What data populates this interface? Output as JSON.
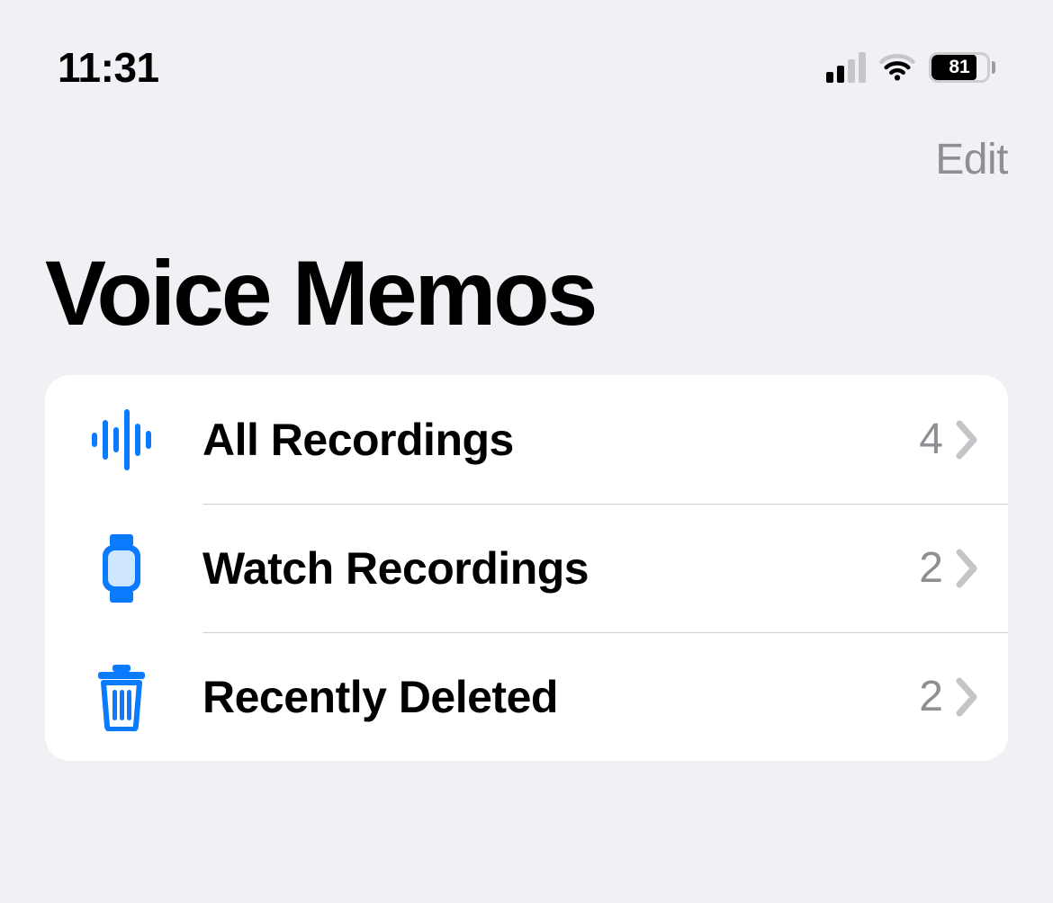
{
  "status_bar": {
    "time": "11:31",
    "battery_percent": "81",
    "cellular_bars_active": 2,
    "wifi_active": true
  },
  "nav": {
    "edit_label": "Edit"
  },
  "page": {
    "title": "Voice Memos"
  },
  "folders": [
    {
      "icon": "waveform",
      "label": "All Recordings",
      "count": "4"
    },
    {
      "icon": "watch",
      "label": "Watch Recordings",
      "count": "2"
    },
    {
      "icon": "trash",
      "label": "Recently Deleted",
      "count": "2"
    }
  ],
  "colors": {
    "accent": "#0a7aff",
    "bg": "#f1f1f5",
    "secondary_text": "#8e8e93"
  }
}
